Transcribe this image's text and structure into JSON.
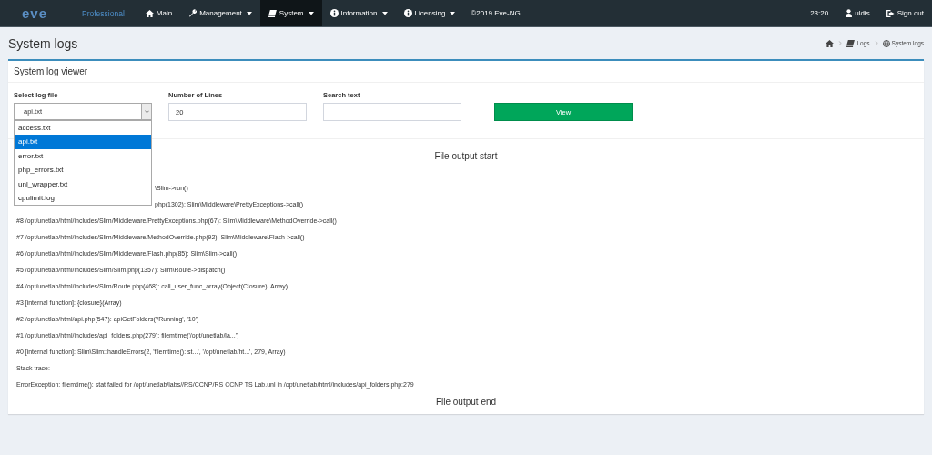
{
  "navbar": {
    "logo": {
      "text": "eve"
    },
    "edition": "Professional",
    "menu": [
      {
        "label": "Main",
        "dropdown": false,
        "selected": false
      },
      {
        "label": "Management",
        "dropdown": true,
        "selected": false
      },
      {
        "label": "System",
        "dropdown": true,
        "selected": true
      },
      {
        "label": "Information",
        "dropdown": true,
        "selected": false
      },
      {
        "label": "Licensing",
        "dropdown": true,
        "selected": false
      }
    ],
    "copyright": "©2019 Eve-NG",
    "time": "23:20",
    "user": "uldis",
    "signout": "Sign out"
  },
  "page": {
    "title": "System logs",
    "breadcrumb": [
      "Logs",
      "System logs"
    ]
  },
  "viewer": {
    "title": "System log viewer",
    "log_file": {
      "label": "Select log file",
      "value": "api.txt",
      "expanded": true,
      "options": [
        {
          "label": "access.txt",
          "selected": false
        },
        {
          "label": "api.txt",
          "selected": true
        },
        {
          "label": "error.txt",
          "selected": false
        },
        {
          "label": "php_errors.txt",
          "selected": false
        },
        {
          "label": "unl_wrapper.txt",
          "selected": false
        },
        {
          "label": "cpulimit.log",
          "selected": false
        }
      ]
    },
    "lines": {
      "label": "Number of Lines",
      "value": "20"
    },
    "search": {
      "label": "Search text"
    },
    "view_button": "View",
    "output_start": "File output start",
    "log_lines": [
      "\\Slim->run()",
      "php(1302): Slim\\Middleware\\PrettyExceptions->call()",
      "#8 /opt/unetlab/html/includes/Slim/Middleware/PrettyExceptions.php(67): Slim\\Middleware\\MethodOverride->call()",
      "#7 /opt/unetlab/html/includes/Slim/Middleware/MethodOverride.php(92): Slim\\Middleware\\Flash->call()",
      "#6 /opt/unetlab/html/includes/Slim/Middleware/Flash.php(85): Slim\\Slim->call()",
      "#5 /opt/unetlab/html/includes/Slim/Slim.php(1357): Slim\\Route->dispatch()",
      "#4 /opt/unetlab/html/includes/Slim/Route.php(468): call_user_func_array(Object(Closure), Array)",
      "#3 [internal function]: {closure}(Array)",
      "#2 /opt/unetlab/html/api.php(547): apiGetFolders('/Running', '10')",
      "#1 /opt/unetlab/html/includes/api_folders.php(279): filemtime('/opt/unetlab/la...')",
      "#0 [internal function]: Slim\\Slim::handleErrors(2, 'filemtime(): st...', '/opt/unetlab/ht...', 279, Array)",
      "Stack trace:",
      "ErrorException: filemtime(): stat failed for /opt/unetlab/labs//RS/CCNP/RS CCNP TS Lab.unl in /opt/unetlab/html/includes/api_folders.php:279"
    ],
    "output_end": "File output end"
  }
}
